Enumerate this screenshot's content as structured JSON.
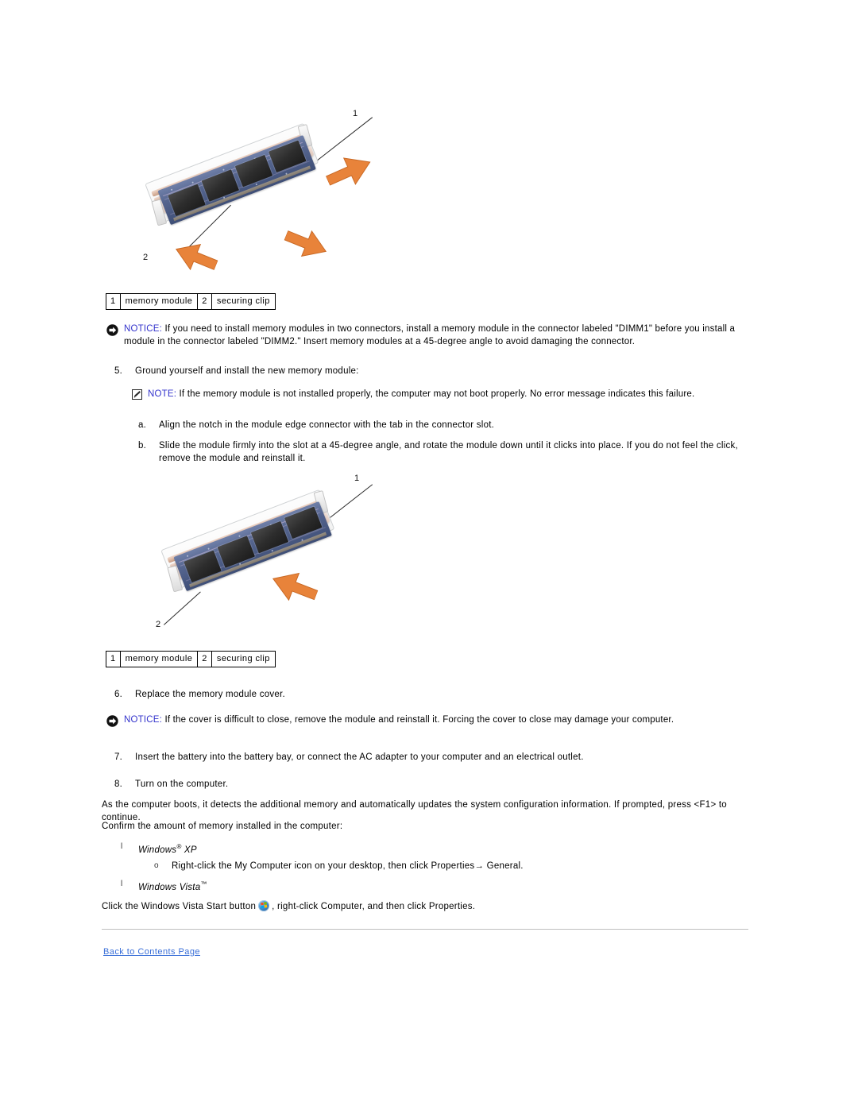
{
  "figures": [
    {
      "name": "memory-module-removal",
      "callouts": [
        {
          "label": "1"
        },
        {
          "label": "2"
        }
      ]
    },
    {
      "name": "memory-module-installation",
      "callouts": [
        {
          "label": "1"
        },
        {
          "label": "2"
        }
      ]
    }
  ],
  "caption_table": {
    "cells": [
      {
        "num": "1",
        "text": "memory module"
      },
      {
        "num": "2",
        "text": "securing clip"
      }
    ]
  },
  "notice_1": {
    "icon": "notice-arrow-icon",
    "label": "NOTICE:",
    "text": " If you need to install memory modules in two connectors, install a memory module in the connector labeled \"DIMM1\" before you install a module in the connector labeled \"DIMM2.\" Insert memory modules at a 45-degree angle to avoid damaging the connector."
  },
  "notice_2": {
    "icon": "notice-arrow-icon",
    "label": "NOTICE:",
    "text": " If the cover is difficult to close, remove the module and reinstall it. Forcing the cover to close may damage your computer."
  },
  "note_1": {
    "icon": "note-pencil-icon",
    "label": "NOTE:",
    "text": " If the memory module is not installed properly, the computer may not boot properly. No error message indicates this failure."
  },
  "steps": {
    "step5": {
      "marker": "5.",
      "text": "Ground yourself and install the new memory module:"
    },
    "step5a": {
      "marker": "a.",
      "text": "Align the notch in the module edge connector with the tab in the connector slot."
    },
    "step5b": {
      "marker": "b.",
      "text": "Slide the module firmly into the slot at a 45-degree angle, and rotate the module down until it clicks into place. If you do not feel the click, remove the module and reinstall it."
    },
    "step6": {
      "marker": "6.",
      "text": "Replace the memory module cover."
    },
    "step7": {
      "marker": "7.",
      "text": "Insert the battery into the battery bay, or connect the AC adapter to your computer and an electrical outlet."
    },
    "step8": {
      "marker": "8.",
      "text": "Turn on the computer."
    }
  },
  "paragraphs": {
    "boot_detect": "As the computer boots, it detects the additional memory and automatically updates the system configuration information. If prompted, press <F1> to continue.",
    "confirm": "Confirm the amount of memory installed in the computer:"
  },
  "os_list": {
    "marker": "l",
    "xp": {
      "name": "Windows",
      "symbol": "®",
      "version": " XP"
    },
    "xp_substep": {
      "marker": "o",
      "text": "Right-click the My Computer icon on your desktop, then click Properties→ General."
    },
    "vista": {
      "name": "Windows Vista",
      "symbol": "™"
    },
    "vista_instruction_before": "Click the Windows Vista Start button",
    "vista_instruction_after": ", right-click Computer, and then click Properties.",
    "vista_orb_icon": "windows-vista-orb-icon"
  },
  "footer": {
    "link_label": "Back to Contents Page"
  },
  "colors": {
    "link": "#3a6fd8",
    "notice_label": "#3333cc",
    "arrow_orange": "#e8833a",
    "rule": "#bfbfbf"
  }
}
